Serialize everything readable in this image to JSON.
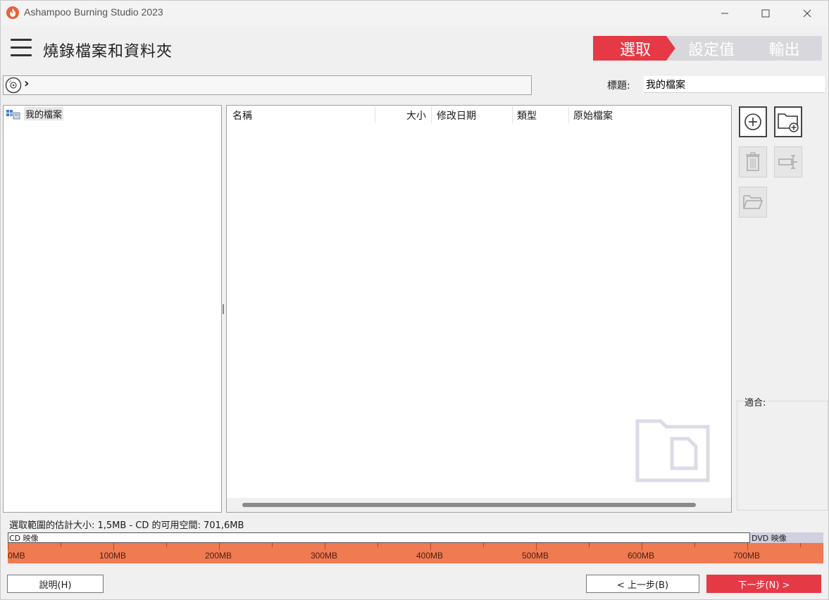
{
  "app": {
    "title": "Ashampoo Burning Studio 2023"
  },
  "header": {
    "page_title": "燒錄檔案和資料夾",
    "steps": [
      "選取",
      "設定值",
      "輸出"
    ],
    "active_step_color": "#e63946",
    "inactive_step_color": "#d8d8dc"
  },
  "path_bar": {
    "separator": "›"
  },
  "disc_title": {
    "label": "標題:",
    "value": "我的檔案"
  },
  "tree": {
    "root_label": "我的檔案"
  },
  "file_list": {
    "columns": [
      "名稱",
      "大小",
      "修改日期",
      "類型",
      "原始檔案"
    ],
    "rows": []
  },
  "tools": [
    {
      "name": "add-file-icon",
      "enabled": true
    },
    {
      "name": "new-folder-icon",
      "enabled": true
    },
    {
      "name": "delete-icon",
      "enabled": false
    },
    {
      "name": "rename-icon",
      "enabled": false
    },
    {
      "name": "open-folder-icon",
      "enabled": false
    }
  ],
  "fit": {
    "label": "適合:"
  },
  "status": {
    "estimate": "選取範圍的估計大小: 1,5MB - CD 的可用空間: 701,6MB",
    "cd_label": "CD 映像",
    "dvd_label": "DVD 映像",
    "scale_labels": [
      "0MB",
      "100MB",
      "200MB",
      "300MB",
      "400MB",
      "500MB",
      "600MB",
      "700MB"
    ],
    "bar_color": "#f07a52"
  },
  "footer": {
    "help_label": "說明(H)",
    "back_label": "< 上一步(B)",
    "next_label": "下一步(N) >"
  }
}
